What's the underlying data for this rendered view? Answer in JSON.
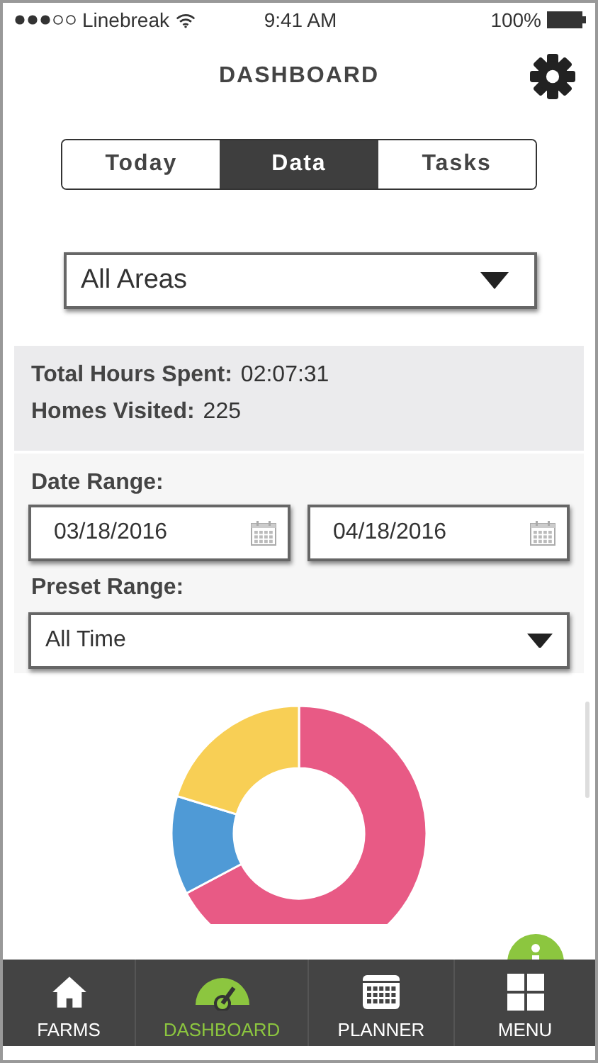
{
  "status_bar": {
    "carrier": "Linebreak",
    "time": "9:41 AM",
    "battery": "100%"
  },
  "header": {
    "title": "DASHBOARD"
  },
  "tabs": [
    {
      "label": "Today",
      "selected": false
    },
    {
      "label": "Data",
      "selected": true
    },
    {
      "label": "Tasks",
      "selected": false
    }
  ],
  "area_select": {
    "value": "All Areas"
  },
  "stats": [
    {
      "label": "Total Hours Spent:",
      "value": "02:07:31"
    },
    {
      "label": "Homes Visited:",
      "value": "225"
    }
  ],
  "date_range": {
    "label": "Date Range:",
    "start": "03/18/2016",
    "end": "04/18/2016"
  },
  "preset_range": {
    "label": "Preset Range:",
    "value": "All Time"
  },
  "nav": [
    {
      "kind": "home",
      "label": "FARMS",
      "selected": false
    },
    {
      "kind": "gauge",
      "label": "DASHBOARD",
      "selected": true
    },
    {
      "kind": "calendar",
      "label": "PLANNER",
      "selected": false
    },
    {
      "kind": "grid",
      "label": "MENU",
      "selected": false
    }
  ]
}
